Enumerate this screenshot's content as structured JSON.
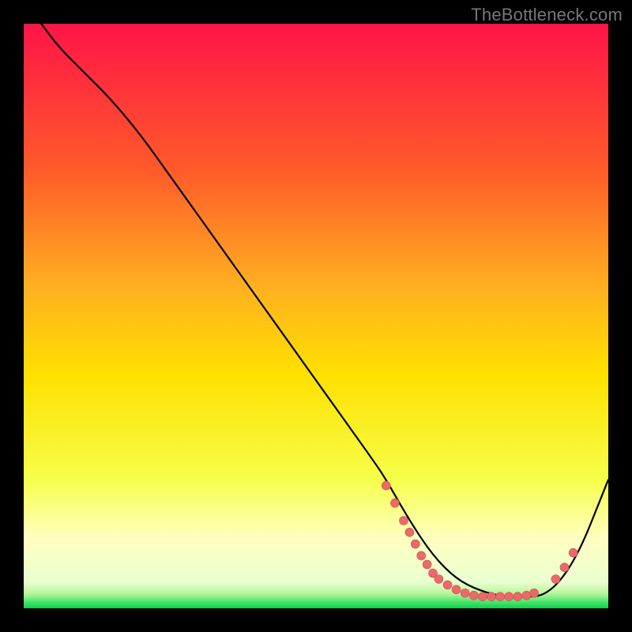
{
  "watermark": "TheBottleneck.com",
  "colors": {
    "top": "#ff1447",
    "mid_upper": "#ff7a1a",
    "mid": "#ffd400",
    "mid_lower": "#f4ff3a",
    "pale": "#ffffb0",
    "green": "#1fe05a",
    "curve_stroke": "#000000",
    "dot_fill": "#e86a6a",
    "dot_stroke": "#d94f4f",
    "frame_bg": "#000000"
  },
  "gradient_stops": [
    {
      "offset": 0.0,
      "color": "#ff1447"
    },
    {
      "offset": 0.25,
      "color": "#ff5a2a"
    },
    {
      "offset": 0.45,
      "color": "#ffb020"
    },
    {
      "offset": 0.6,
      "color": "#ffe000"
    },
    {
      "offset": 0.78,
      "color": "#f6ff4a"
    },
    {
      "offset": 0.88,
      "color": "#ffffc0"
    },
    {
      "offset": 0.955,
      "color": "#eaffd0"
    },
    {
      "offset": 0.975,
      "color": "#b6f59a"
    },
    {
      "offset": 0.99,
      "color": "#3fe66a"
    },
    {
      "offset": 1.0,
      "color": "#18c94d"
    }
  ],
  "chart_data": {
    "type": "line",
    "title": "",
    "xlabel": "",
    "ylabel": "",
    "xlim": [
      0,
      100
    ],
    "ylim": [
      0,
      100
    ],
    "series": [
      {
        "name": "curve",
        "x": [
          3,
          6,
          10,
          15,
          20,
          25,
          30,
          35,
          40,
          45,
          50,
          55,
          60,
          62,
          66,
          70,
          74,
          78,
          82,
          85,
          88,
          90,
          92,
          94,
          96,
          98,
          100
        ],
        "y": [
          100,
          96,
          92,
          87,
          81,
          74,
          67,
          60,
          53,
          46,
          39,
          32,
          25,
          22,
          15,
          9,
          5,
          3,
          2,
          2,
          2,
          3,
          5,
          8,
          12,
          17,
          22
        ]
      }
    ],
    "dots": {
      "name": "highlight-dots",
      "points": [
        {
          "x": 62,
          "y": 21
        },
        {
          "x": 63.5,
          "y": 18
        },
        {
          "x": 65,
          "y": 15
        },
        {
          "x": 66,
          "y": 13
        },
        {
          "x": 67,
          "y": 11
        },
        {
          "x": 68,
          "y": 9
        },
        {
          "x": 69,
          "y": 7.5
        },
        {
          "x": 70,
          "y": 6
        },
        {
          "x": 71,
          "y": 5
        },
        {
          "x": 72.5,
          "y": 4
        },
        {
          "x": 74,
          "y": 3.2
        },
        {
          "x": 75.5,
          "y": 2.6
        },
        {
          "x": 77,
          "y": 2.2
        },
        {
          "x": 78.5,
          "y": 2
        },
        {
          "x": 80,
          "y": 2
        },
        {
          "x": 81.5,
          "y": 2
        },
        {
          "x": 83,
          "y": 2
        },
        {
          "x": 84.5,
          "y": 2
        },
        {
          "x": 86,
          "y": 2.2
        },
        {
          "x": 87.3,
          "y": 2.6
        },
        {
          "x": 91,
          "y": 5
        },
        {
          "x": 92.5,
          "y": 7
        },
        {
          "x": 94,
          "y": 9.5
        }
      ]
    }
  }
}
